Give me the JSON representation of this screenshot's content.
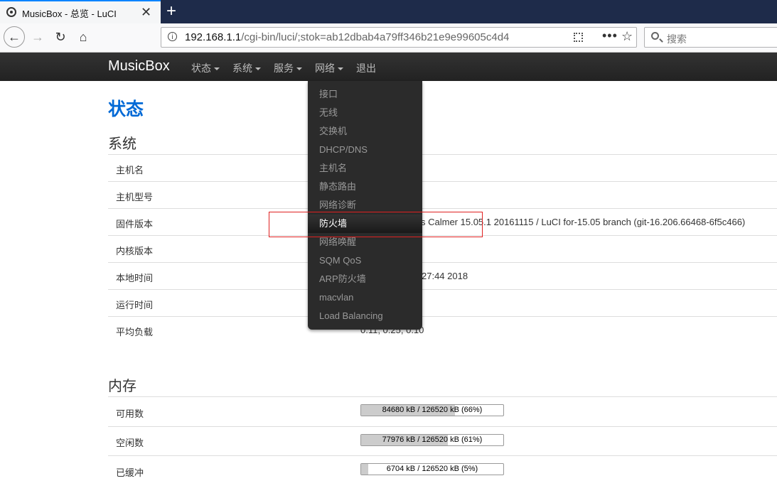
{
  "browser": {
    "tab_title": "MusicBox - 总览 - LuCI",
    "tab_close": "✕",
    "new_tab": "+",
    "url_host": "192.168.1.1",
    "url_path": "/cgi-bin/luci/;stok=ab12dbab4a79ff346b21e9e99605c4d4",
    "search_placeholder": "搜索",
    "icons": {
      "back": "back-arrow-icon",
      "forward": "forward-arrow-icon",
      "reload": "reload-icon",
      "home": "home-icon",
      "info": "info-icon",
      "qr": "qr-code-icon",
      "more": "page-actions-icon",
      "bookmark": "bookmark-star-icon",
      "search": "search-icon"
    }
  },
  "header": {
    "brand": "MusicBox",
    "menu": [
      {
        "label": "状态",
        "has_caret": true
      },
      {
        "label": "系统",
        "has_caret": true
      },
      {
        "label": "服务",
        "has_caret": true
      },
      {
        "label": "网络",
        "has_caret": true
      },
      {
        "label": "退出",
        "has_caret": false
      }
    ]
  },
  "dropdown": {
    "items": [
      {
        "label": "接口"
      },
      {
        "label": "无线"
      },
      {
        "label": "交换机"
      },
      {
        "label": "DHCP/DNS"
      },
      {
        "label": "主机名"
      },
      {
        "label": "静态路由"
      },
      {
        "label": "网络诊断"
      },
      {
        "label": "防火墙",
        "active": true
      },
      {
        "label": "网络唤醒"
      },
      {
        "label": "SQM QoS"
      },
      {
        "label": "ARP防火墙"
      },
      {
        "label": "macvlan"
      },
      {
        "label": "Load Balancing"
      }
    ]
  },
  "page": {
    "title": "状态",
    "system": {
      "heading": "系统",
      "rows": [
        {
          "label": "主机名",
          "value": ""
        },
        {
          "label": "主机型号",
          "value": ""
        },
        {
          "label": "固件版本",
          "value": "s Calmer 15.05.1 20161115 / LuCI for-15.05 branch (git-16.206.66468-6f5c466)"
        },
        {
          "label": "内核版本",
          "value": ""
        },
        {
          "label": "本地时间",
          "value": "27:44 2018"
        },
        {
          "label": "运行时间",
          "value": ""
        },
        {
          "label": "平均负载",
          "value": "0.11, 0.25, 0.10"
        }
      ]
    },
    "memory": {
      "heading": "内存",
      "rows": [
        {
          "label": "可用数",
          "bar_text": "84680 kB / 126520 kB (66%)",
          "percent": 66
        },
        {
          "label": "空闲数",
          "bar_text": "77976 kB / 126520 kB (61%)",
          "percent": 61
        },
        {
          "label": "已缓冲",
          "bar_text": "6704 kB / 126520 kB (5%)",
          "percent": 5
        }
      ]
    }
  }
}
